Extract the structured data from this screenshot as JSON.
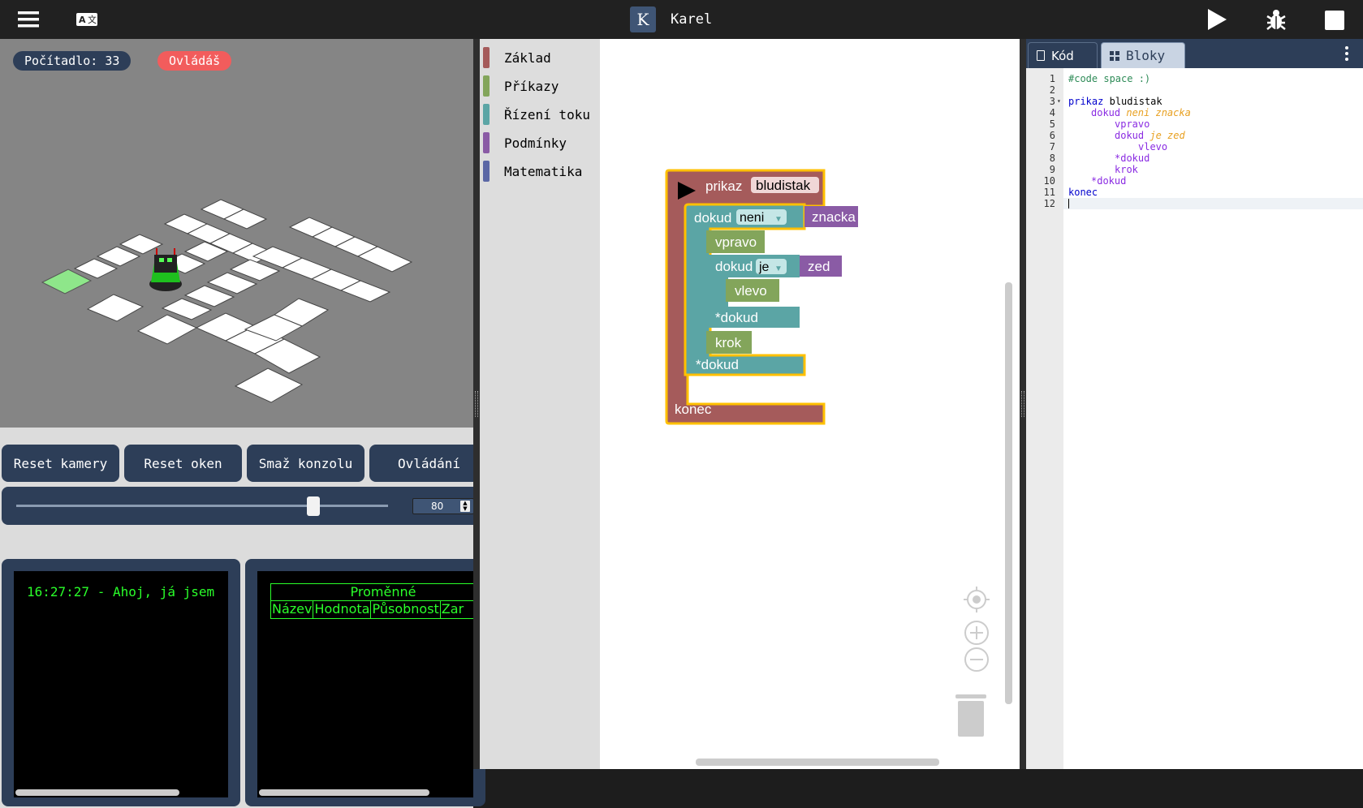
{
  "topbar": {
    "menu_icon": "hamburger-menu-icon",
    "translate_icon": "translate-icon",
    "logo_letter": "K",
    "app_title": "Karel",
    "run_icon": "play-icon",
    "debug_icon": "bug-icon",
    "stop_icon": "stop-icon"
  },
  "scene": {
    "counter_label": "Počítadlo: 33",
    "mode_badge": "Ovládáš"
  },
  "controls": {
    "reset_camera": "Reset kamery",
    "reset_windows": "Reset oken",
    "clear_console": "Smaž konzolu",
    "controls_label": "Ovládání",
    "speed_value": "80",
    "speed_fraction": 0.8
  },
  "console": {
    "line": "16:27:27 - Ahoj, já jsem"
  },
  "variables": {
    "title": "Proměnné",
    "columns": [
      "Název",
      "Hodnota",
      "Působnost",
      "Zar"
    ]
  },
  "toolbox": {
    "categories": [
      {
        "label": "Základ",
        "color": "#a55b5b"
      },
      {
        "label": "Příkazy",
        "color": "#83a55b"
      },
      {
        "label": "Řízení toku",
        "color": "#5ba5a5"
      },
      {
        "label": "Podmínky",
        "color": "#8a5ba5"
      },
      {
        "label": "Matematika",
        "color": "#5b67a5"
      }
    ]
  },
  "blocks": {
    "prikaz": "prikaz",
    "proc_name": "bludistak",
    "dokud1": "dokud",
    "dokud1_op": "neni",
    "dokud1_cond": "znacka",
    "vpravo": "vpravo",
    "dokud2": "dokud",
    "dokud2_op": "je",
    "dokud2_cond": "zed",
    "vlevo": "vlevo",
    "end_dokud_inner": "*dokud",
    "krok": "krok",
    "end_dokud_outer": "*dokud",
    "konec": "konec"
  },
  "workspace_icons": {
    "center": "target-icon",
    "zoom_in": "zoom-in-icon",
    "zoom_out": "zoom-out-icon",
    "trash": "trash-icon"
  },
  "code_panel": {
    "tab_code": "Kód",
    "tab_blocks": "Bloky",
    "tab_code_icon": "file-code-icon",
    "tab_blocks_icon": "grid-icon",
    "more_icon": "kebab-menu-icon",
    "line_numbers": [
      "1",
      "2",
      "3",
      "4",
      "5",
      "6",
      "7",
      "8",
      "9",
      "10",
      "11",
      "12"
    ]
  },
  "code": {
    "l1": "#code space :)",
    "l3_kw": "prikaz",
    "l3_name": "bludistak",
    "l4_kw": "dokud",
    "l4_cond": "neni znacka",
    "l5": "vpravo",
    "l6_kw": "dokud",
    "l6_cond": "je zed",
    "l7": "vlevo",
    "l8": "*dokud",
    "l9": "krok",
    "l10": "*dokud",
    "l11": "konec"
  },
  "colors": {
    "panel_blue": "#2d3e58",
    "proc_red": "#a55b5b",
    "loop_teal": "#5ba5a5",
    "cmd_green": "#83a55b",
    "cond_purple": "#8a5ba5",
    "selection": "#ffc000"
  }
}
